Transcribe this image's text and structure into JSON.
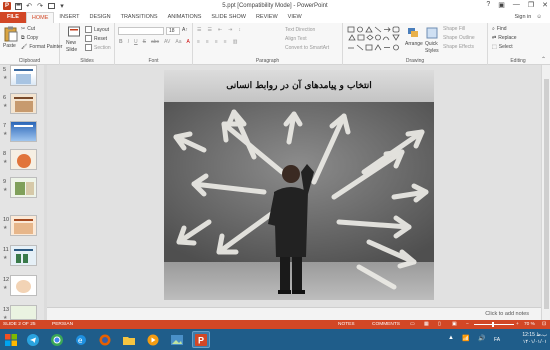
{
  "window": {
    "title": "5.ppt [Compatibility Mode] - PowerPoint",
    "controls": [
      "?",
      "—",
      "❐",
      "✕"
    ]
  },
  "tabs": [
    "FILE",
    "HOME",
    "INSERT",
    "DESIGN",
    "TRANSITIONS",
    "ANIMATIONS",
    "SLIDE SHOW",
    "REVIEW",
    "VIEW"
  ],
  "account": {
    "signin": "Sign in"
  },
  "ribbon": {
    "clipboard": {
      "label": "Clipboard",
      "paste": "Paste",
      "cut": "Cut",
      "copy": "Copy",
      "format_painter": "Format Painter"
    },
    "slides": {
      "label": "Slides",
      "new_slide": "New",
      "new_slide2": "Slide",
      "layout": "Layout",
      "reset": "Reset",
      "section": "Section"
    },
    "font": {
      "label": "Font",
      "bold": "B",
      "italic": "I",
      "underline": "U",
      "strike": "S",
      "abc": "abc",
      "spacing": "AV",
      "case": "Aa",
      "color": "A",
      "size": "18"
    },
    "paragraph": {
      "label": "Paragraph",
      "text_direction": "Text Direction",
      "align_text": "Align Text",
      "convert_smartart": "Convert to SmartArt"
    },
    "drawing": {
      "label": "Drawing",
      "arrange": "Arrange",
      "quick_styles": "Quick",
      "quick_styles2": "Styles",
      "shape_fill": "Shape Fill",
      "shape_outline": "Shape Outline",
      "shape_effects": "Shape Effects"
    },
    "editing": {
      "label": "Editing",
      "find": "Find",
      "replace": "Replace",
      "select": "Select"
    }
  },
  "thumbnails": [
    {
      "num": "5",
      "star": "★"
    },
    {
      "num": "6",
      "star": "★"
    },
    {
      "num": "7",
      "star": "★"
    },
    {
      "num": "8",
      "star": "★"
    },
    {
      "num": "9",
      "star": "★"
    },
    {
      "num": "10",
      "star": "★"
    },
    {
      "num": "11",
      "star": "★"
    },
    {
      "num": "12",
      "star": "★"
    },
    {
      "num": "13",
      "star": "★"
    }
  ],
  "slide": {
    "title": "انتخاب و پیامدهای آن در روابط انسانی"
  },
  "notes": {
    "placeholder": "Click to add notes"
  },
  "status": {
    "slide_counter": "SLIDE 2 OF 25",
    "language": "PERSIAN",
    "notes": "NOTES",
    "comments": "COMMENTS",
    "zoom": "70 %"
  },
  "taskbar": {
    "time": "12:15 ب.ظ",
    "date": "۱۴۰۱/۰۱/۰۱",
    "lang": "FA"
  },
  "colors": {
    "accent": "#d24726",
    "taskbar": "#1f5d8a"
  }
}
